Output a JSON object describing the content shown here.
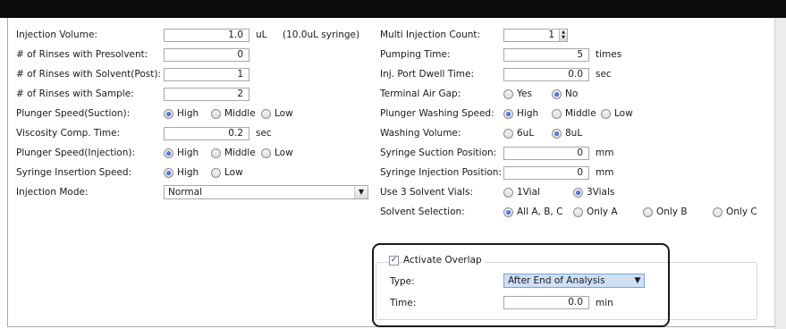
{
  "left": {
    "injection_volume": {
      "label": "Injection Volume:",
      "value": "1.0",
      "unit": "uL",
      "note": "(10.0uL syringe)"
    },
    "rinses_presolvent": {
      "label": "# of Rinses with Presolvent:",
      "value": "0"
    },
    "rinses_solvent_post": {
      "label": "# of Rinses with Solvent(Post):",
      "value": "1"
    },
    "rinses_sample": {
      "label": "# of Rinses with Sample:",
      "value": "2"
    },
    "plunger_speed_suction": {
      "label": "Plunger Speed(Suction):",
      "options": [
        "High",
        "Middle",
        "Low"
      ],
      "selected": "High"
    },
    "viscosity_comp_time": {
      "label": "Viscosity Comp. Time:",
      "value": "0.2",
      "unit": "sec"
    },
    "plunger_speed_injection": {
      "label": "Plunger Speed(Injection):",
      "options": [
        "High",
        "Middle",
        "Low"
      ],
      "selected": "High"
    },
    "syringe_insertion_speed": {
      "label": "Syringe Insertion Speed:",
      "options": [
        "High",
        "Low"
      ],
      "selected": "High"
    },
    "injection_mode": {
      "label": "Injection Mode:",
      "value": "Normal"
    }
  },
  "right": {
    "multi_injection_count": {
      "label": "Multi Injection Count:",
      "value": "1"
    },
    "pumping_time": {
      "label": "Pumping Time:",
      "value": "5",
      "unit": "times"
    },
    "inj_port_dwell_time": {
      "label": "Inj. Port Dwell Time:",
      "value": "0.0",
      "unit": "sec"
    },
    "terminal_air_gap": {
      "label": "Terminal Air Gap:",
      "options": [
        "Yes",
        "No"
      ],
      "selected": "No"
    },
    "plunger_washing_speed": {
      "label": "Plunger Washing Speed:",
      "options": [
        "High",
        "Middle",
        "Low"
      ],
      "selected": "High"
    },
    "washing_volume": {
      "label": "Washing Volume:",
      "options": [
        "6uL",
        "8uL"
      ],
      "selected": "8uL"
    },
    "syringe_suction_position": {
      "label": "Syringe Suction Position:",
      "value": "0",
      "unit": "mm"
    },
    "syringe_injection_position": {
      "label": "Syringe Injection Position:",
      "value": "0",
      "unit": "mm"
    },
    "use_3_solvent_vials": {
      "label": "Use 3 Solvent Vials:",
      "options": [
        "1Vial",
        "3Vials"
      ],
      "selected": "3Vials"
    },
    "solvent_selection": {
      "label": "Solvent Selection:",
      "options": [
        "All A, B, C",
        "Only A",
        "Only B",
        "Only C"
      ],
      "selected": "All A, B, C"
    }
  },
  "overlap": {
    "checkbox_label": "Activate Overlap",
    "checked": true,
    "type_label": "Type:",
    "type_value": "After End of Analysis",
    "time_label": "Time:",
    "time_value": "0.0",
    "time_unit": "min"
  },
  "colors": {
    "title_bar": "#0b0b0b",
    "radio_selected": "#1a3fb5",
    "combo_highlight": "#cfe0f5"
  }
}
